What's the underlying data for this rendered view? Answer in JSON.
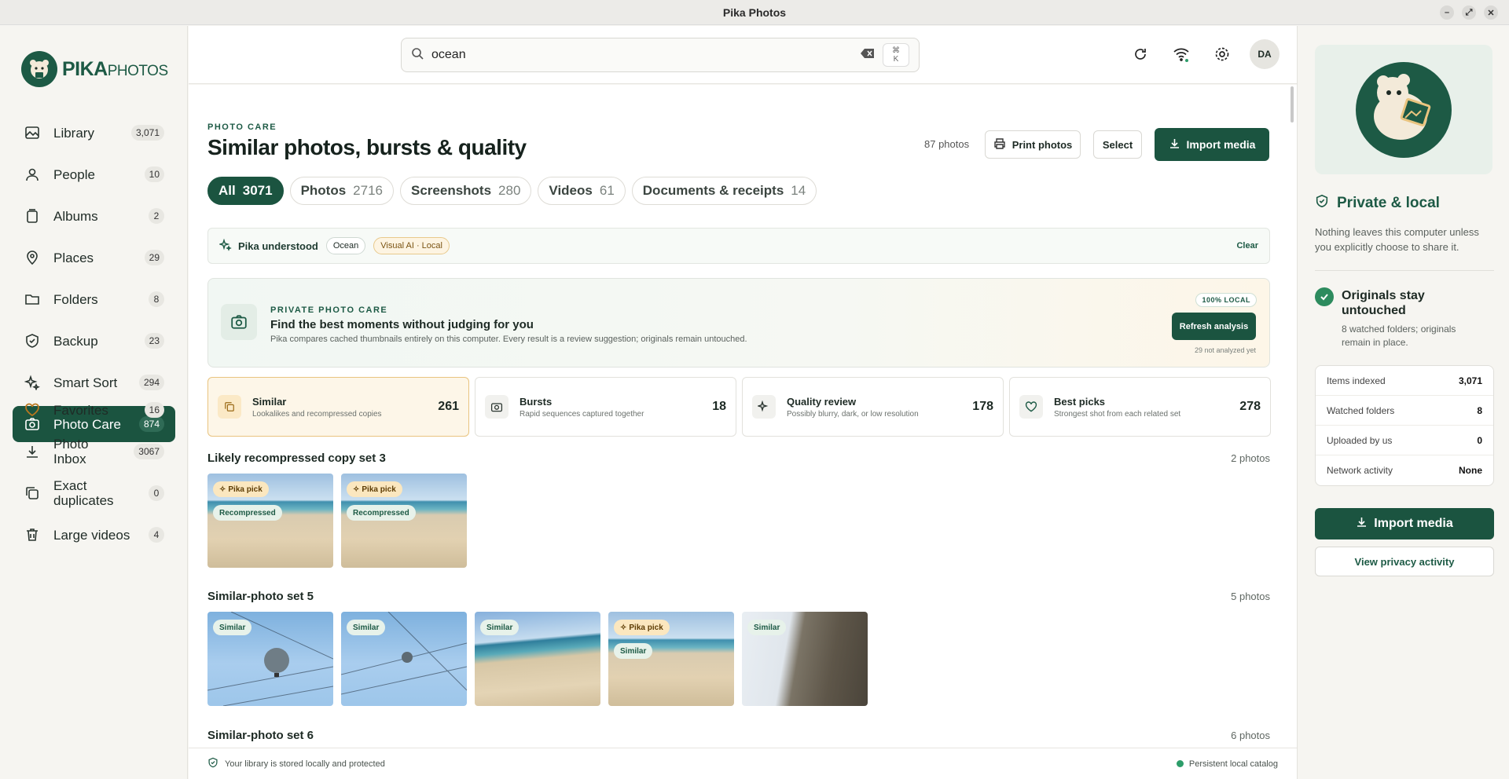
{
  "window": {
    "title": "Pika Photos"
  },
  "logo": {
    "brand": "PIKA",
    "brand_suffix": "PHOTOS"
  },
  "sidebar": {
    "items": [
      {
        "label": "Library",
        "count": "3,071",
        "icon": "image-icon"
      },
      {
        "label": "People",
        "count": "10",
        "icon": "person-icon"
      },
      {
        "label": "Albums",
        "count": "2",
        "icon": "album-icon"
      },
      {
        "label": "Places",
        "count": "29",
        "icon": "pin-icon"
      },
      {
        "label": "Folders",
        "count": "8",
        "icon": "folder-icon"
      },
      {
        "label": "Backup",
        "count": "23",
        "icon": "shield-icon"
      },
      {
        "label": "Smart Sort",
        "count": "294",
        "icon": "sparkle-icon"
      },
      {
        "label": "Photo Care",
        "count": "874",
        "icon": "camera-icon"
      }
    ],
    "secondary": [
      {
        "label": "Favorites",
        "count": "16",
        "icon": "heart-icon"
      },
      {
        "label": "Photo Inbox",
        "count": "3067",
        "icon": "download-icon"
      },
      {
        "label": "Exact duplicates",
        "count": "0",
        "icon": "copy-icon"
      },
      {
        "label": "Large videos",
        "count": "4",
        "icon": "trash-icon"
      }
    ]
  },
  "search": {
    "value": "ocean",
    "shortcut_top": "⌘",
    "shortcut_bottom": "K"
  },
  "header": {
    "eyebrow": "PHOTO CARE",
    "title": "Similar photos, bursts & quality",
    "photo_count": "87 photos",
    "print_label": "Print photos",
    "select_label": "Select",
    "import_label": "Import media"
  },
  "filters": [
    {
      "label": "All",
      "count": "3071"
    },
    {
      "label": "Photos",
      "count": "2716"
    },
    {
      "label": "Screenshots",
      "count": "280"
    },
    {
      "label": "Videos",
      "count": "61"
    },
    {
      "label": "Documents & receipts",
      "count": "14"
    }
  ],
  "understood": {
    "label": "Pika understood",
    "tag1": "Ocean",
    "tag2": "Visual AI · Local",
    "clear": "Clear"
  },
  "care": {
    "eyebrow": "PRIVATE PHOTO CARE",
    "title": "Find the best moments without judging for you",
    "desc": "Pika compares cached thumbnails entirely on this computer. Every result is a review suggestion; originals remain untouched.",
    "badge": "100% LOCAL",
    "button": "Refresh analysis",
    "note": "29 not analyzed yet"
  },
  "stats": [
    {
      "title": "Similar",
      "sub": "Lookalikes and recompressed copies",
      "value": "261"
    },
    {
      "title": "Bursts",
      "sub": "Rapid sequences captured together",
      "value": "18"
    },
    {
      "title": "Quality review",
      "sub": "Possibly blurry, dark, or low resolution",
      "value": "178"
    },
    {
      "title": "Best picks",
      "sub": "Strongest shot from each related set",
      "value": "278"
    }
  ],
  "sets": [
    {
      "title": "Likely recompressed copy set 3",
      "count": "2 photos"
    },
    {
      "title": "Similar-photo set 5",
      "count": "5 photos"
    },
    {
      "title": "Similar-photo set 6",
      "count": "6 photos"
    }
  ],
  "badges": {
    "pick": "Pika pick",
    "recompressed": "Recompressed",
    "similar": "Similar"
  },
  "footer": {
    "left": "Your library is stored locally and protected",
    "right": "Persistent local catalog"
  },
  "right_panel": {
    "title": "Private & local",
    "desc": "Nothing leaves this computer unless you explicitly choose to share it.",
    "originals_title": "Originals stay untouched",
    "originals_desc": "8 watched folders; originals remain in place.",
    "rows": [
      {
        "label": "Items indexed",
        "value": "3,071"
      },
      {
        "label": "Watched folders",
        "value": "8"
      },
      {
        "label": "Uploaded by us",
        "value": "0"
      },
      {
        "label": "Network activity",
        "value": "None"
      }
    ],
    "import_label": "Import media",
    "privacy_label": "View privacy activity"
  },
  "colors": {
    "accent": "#1b5440",
    "amber": "#e9c47f"
  }
}
